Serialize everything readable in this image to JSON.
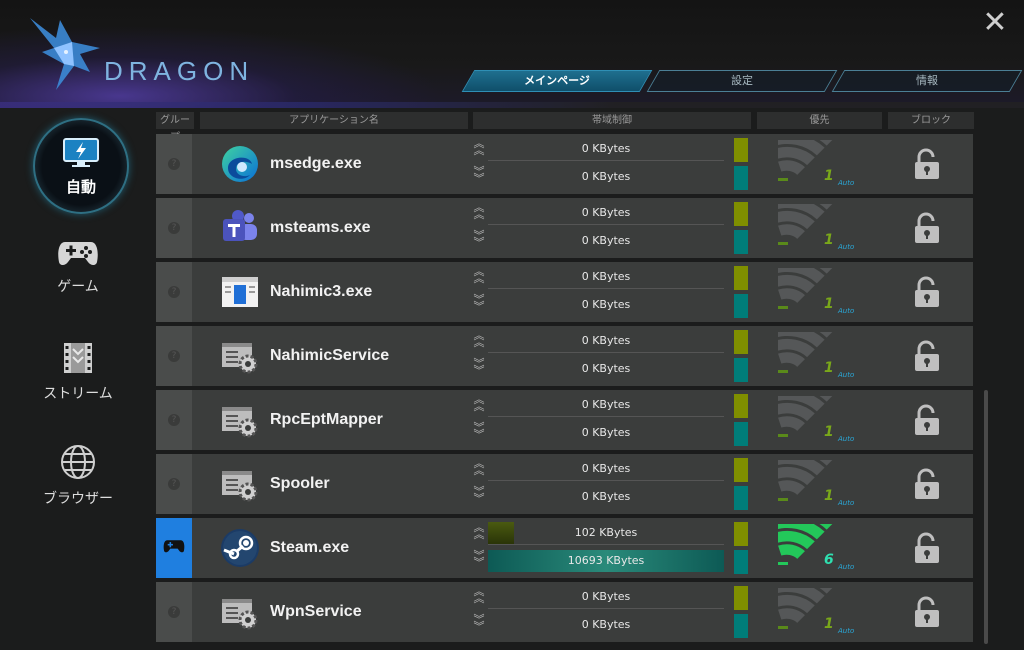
{
  "brand": {
    "name": "DRAGON"
  },
  "window": {
    "close_glyph": "✕"
  },
  "tabs": [
    {
      "label": "メインページ",
      "active": true
    },
    {
      "label": "設定",
      "active": false
    },
    {
      "label": "情報",
      "active": false
    }
  ],
  "sidebar": {
    "items": [
      {
        "label": "自動",
        "icon": "monitor-bolt-icon",
        "active": true
      },
      {
        "label": "ゲーム",
        "icon": "gamepad-icon",
        "active": false
      },
      {
        "label": "ストリーム",
        "icon": "film-icon",
        "active": false
      },
      {
        "label": "ブラウザー",
        "icon": "globe-icon",
        "active": false
      }
    ]
  },
  "columns": [
    "グループ",
    "アプリケーション名",
    "帯域制御",
    "優先",
    "ブロック"
  ],
  "rows": [
    {
      "name": "msedge.exe",
      "icon": "edge-icon",
      "up": "0 KBytes",
      "down": "0 KBytes",
      "group_active": false,
      "priority_mode": "Auto"
    },
    {
      "name": "msteams.exe",
      "icon": "teams-icon",
      "up": "0 KBytes",
      "down": "0 KBytes",
      "group_active": false,
      "priority_mode": "Auto"
    },
    {
      "name": "Nahimic3.exe",
      "icon": "nahimic-icon",
      "up": "0 KBytes",
      "down": "0 KBytes",
      "group_active": false,
      "priority_mode": "Auto"
    },
    {
      "name": "NahimicService",
      "icon": "service-icon",
      "up": "0 KBytes",
      "down": "0 KBytes",
      "group_active": false,
      "priority_mode": "Auto"
    },
    {
      "name": "RpcEptMapper",
      "icon": "service-icon",
      "up": "0 KBytes",
      "down": "0 KBytes",
      "group_active": false,
      "priority_mode": "Auto"
    },
    {
      "name": "Spooler",
      "icon": "service-icon",
      "up": "0 KBytes",
      "down": "0 KBytes",
      "group_active": false,
      "priority_mode": "Auto"
    },
    {
      "name": "Steam.exe",
      "icon": "steam-icon",
      "up": "102 KBytes",
      "down": "10693 KBytes",
      "group_active": true,
      "group_icon": "gamepad-icon",
      "priority_mode": "Auto",
      "priority_level": "6",
      "up_fill": 0.11,
      "down_fill": 1.0
    },
    {
      "name": "WpnService",
      "icon": "service-icon",
      "up": "0 KBytes",
      "down": "0 KBytes",
      "group_active": false,
      "priority_mode": "Auto"
    }
  ],
  "colors": {
    "accent": "#1f7fe0",
    "up_bar": "#7f8f00",
    "down_bar": "#007d79",
    "priority_green": "#23c85a"
  }
}
